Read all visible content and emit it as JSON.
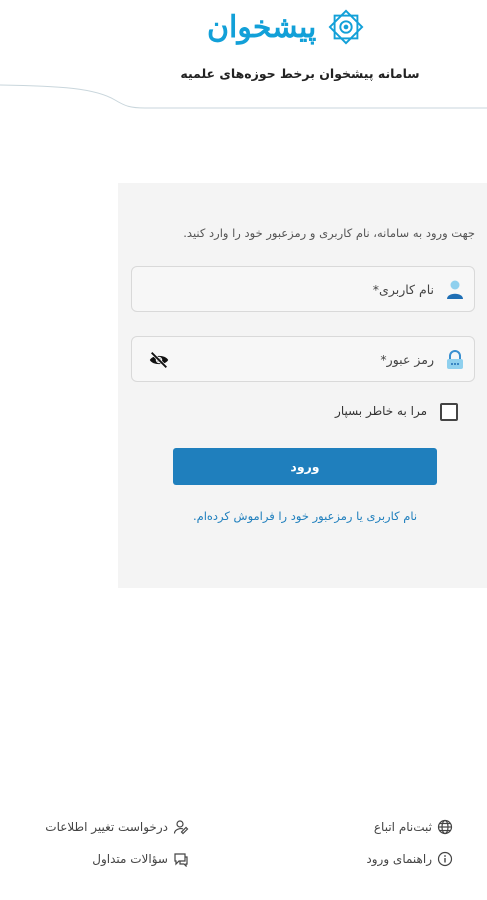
{
  "header": {
    "logo_text": "پیشخوان",
    "site_title": "سامانه پیشخوان برخط حوزه‌های علمیه"
  },
  "login": {
    "intro": "جهت ورود به سامانه، نام کاربری و رمزعبور خود را وارد کنید.",
    "username_placeholder": "نام کاربری*",
    "password_placeholder": "رمز عبور*",
    "remember_label": "مرا به خاطر بسپار",
    "submit_label": "ورود",
    "forgot_link": "نام کاربری یا رمزعبور خود را فراموش کرده‌ام."
  },
  "footer": {
    "register": "ثبت‌نام اتباع",
    "guide": "راهنمای ورود",
    "change_request": "درخواست تغییر اطلاعات",
    "faq": "سؤالات متداول"
  },
  "colors": {
    "brand_blue": "#12a0d8",
    "button_blue": "#1f7fbd",
    "card_bg": "#f4f4f4"
  },
  "icons": {
    "username": "user-icon",
    "password": "lock-icon",
    "toggle_password": "eye-slash-icon",
    "register": "globe-icon",
    "guide": "info-circle-icon",
    "change_request": "user-edit-icon",
    "faq": "chat-icon"
  }
}
